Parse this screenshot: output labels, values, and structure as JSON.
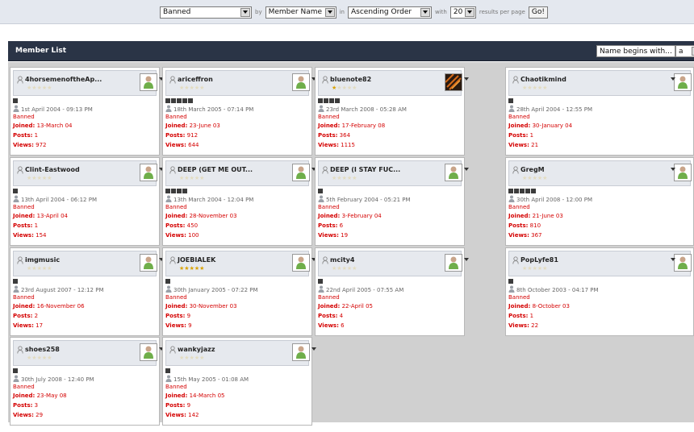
{
  "filters": {
    "group_select": "Banned",
    "by_label": "by",
    "field_select": "Member Name",
    "in_label": "in",
    "order_select": "Ascending Order",
    "with_label": "with",
    "per_page_select": "20",
    "results_label": "results per page",
    "go_label": "Go!"
  },
  "header": {
    "title": "Member List",
    "name_begins_label": "Name begins with...",
    "letter_select": "a"
  },
  "labels": {
    "joined": "Joined:",
    "posts": "Posts:",
    "views": "Views:"
  },
  "members": [
    {
      "name": "4horsemenoftheAp...",
      "stars": 0,
      "pips": 1,
      "last": "1st April 2004 - 09:13 PM",
      "status": "Banned",
      "joined": "13-March 04",
      "posts": "1",
      "views": "972",
      "avatar": "default"
    },
    {
      "name": "ariceffron",
      "stars": 0,
      "pips": 5,
      "last": "18th March 2005 - 07:14 PM",
      "status": "Banned",
      "joined": "23-June 03",
      "posts": "912",
      "views": "644",
      "avatar": "default"
    },
    {
      "name": "bluenote82",
      "stars": 1,
      "pips": 4,
      "last": "23rd March 2008 - 05:28 AM",
      "status": "Banned",
      "joined": "17-February 08",
      "posts": "364",
      "views": "1115",
      "avatar": "image"
    },
    {
      "name": "Chaotikmind",
      "stars": 0,
      "pips": 1,
      "last": "28th April 2004 - 12:55 PM",
      "status": "Banned",
      "joined": "30-January 04",
      "posts": "1",
      "views": "21",
      "avatar": "default"
    },
    {
      "name": "Clint-Eastwood",
      "stars": 0,
      "pips": 1,
      "last": "13th April 2004 - 06:12 PM",
      "status": "Banned",
      "joined": "13-April 04",
      "posts": "1",
      "views": "154",
      "avatar": "default"
    },
    {
      "name": "DEEP (GET ME OUT...",
      "stars": 0,
      "pips": 4,
      "last": "13th March 2004 - 12:04 PM",
      "status": "Banned",
      "joined": "28-November 03",
      "posts": "450",
      "views": "100",
      "avatar": "default"
    },
    {
      "name": "DEEP (I STAY FUC...",
      "stars": 0,
      "pips": 1,
      "last": "5th February 2004 - 05:21 PM",
      "status": "Banned",
      "joined": "3-February 04",
      "posts": "6",
      "views": "19",
      "avatar": "default"
    },
    {
      "name": "GregM",
      "stars": 0,
      "pips": 5,
      "last": "30th April 2008 - 12:00 PM",
      "status": "Banned",
      "joined": "21-June 03",
      "posts": "810",
      "views": "367",
      "avatar": "default"
    },
    {
      "name": "imgmusic",
      "stars": 0,
      "pips": 1,
      "last": "23rd August 2007 - 12:12 PM",
      "status": "Banned",
      "joined": "16-November 06",
      "posts": "2",
      "views": "17",
      "avatar": "default"
    },
    {
      "name": "JOEBIALEK",
      "stars": 5,
      "pips": 1,
      "last": "30th January 2005 - 07:22 PM",
      "status": "Banned",
      "joined": "30-November 03",
      "posts": "9",
      "views": "9",
      "avatar": "default"
    },
    {
      "name": "mcity4",
      "stars": 0,
      "pips": 1,
      "last": "22nd April 2005 - 07:55 AM",
      "status": "Banned",
      "joined": "22-April 05",
      "posts": "4",
      "views": "6",
      "avatar": "default"
    },
    {
      "name": "PopLyfe81",
      "stars": 0,
      "pips": 1,
      "last": "8th October 2003 - 04:17 PM",
      "status": "Banned",
      "joined": "8-October 03",
      "posts": "1",
      "views": "22",
      "avatar": "default"
    },
    {
      "name": "shoes258",
      "stars": 0,
      "pips": 1,
      "last": "30th July 2008 - 12:40 PM",
      "status": "Banned",
      "joined": "23-May 08",
      "posts": "3",
      "views": "29",
      "avatar": "default"
    },
    {
      "name": "wankyjazz",
      "stars": 0,
      "pips": 1,
      "last": "15th May 2005 - 01:08 AM",
      "status": "Banned",
      "joined": "14-March 05",
      "posts": "9",
      "views": "142",
      "avatar": "default"
    }
  ]
}
